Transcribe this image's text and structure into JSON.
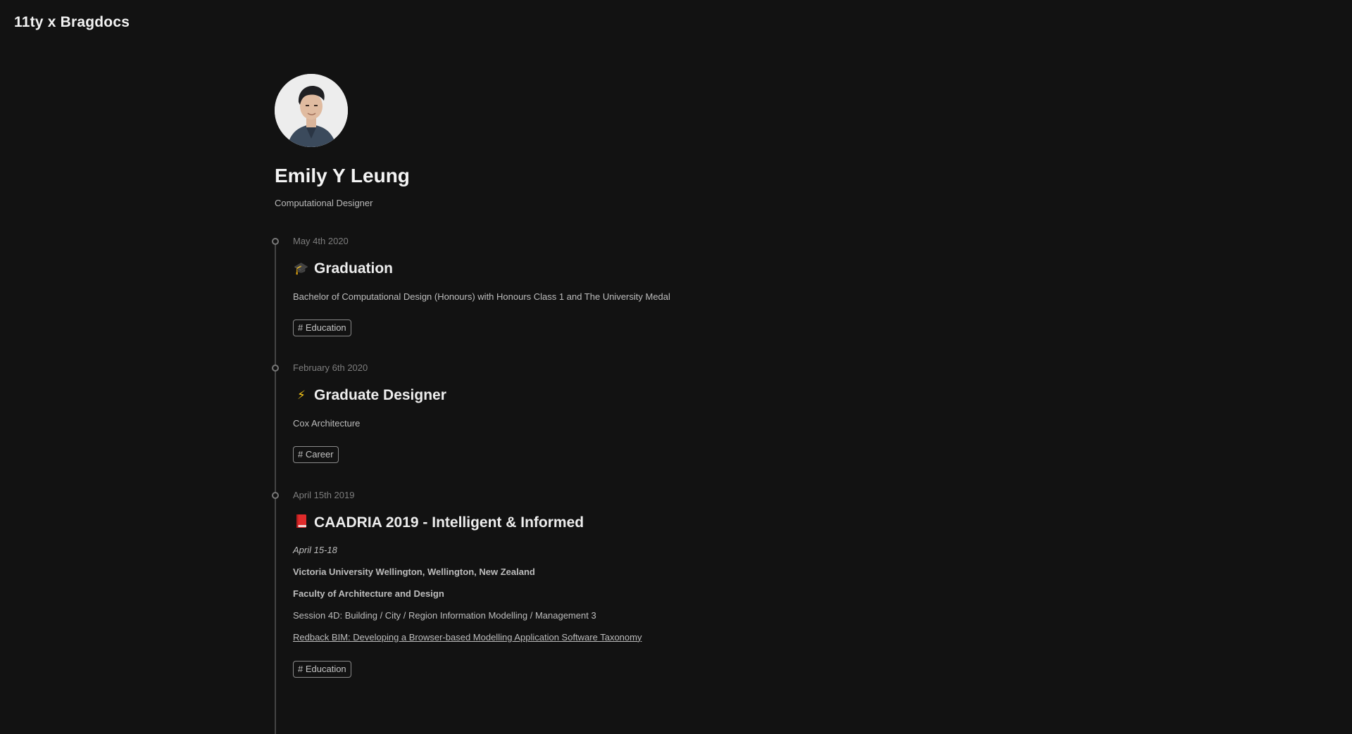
{
  "site": {
    "title": "11ty x Bragdocs"
  },
  "profile": {
    "name": "Emily Y Leung",
    "role": "Computational Designer",
    "avatar_icon": "profile-photo"
  },
  "entries": [
    {
      "date": "May 4th 2020",
      "emoji": "🎓",
      "emoji_icon": "graduation-cap-icon",
      "title": "Graduation",
      "description": "Bachelor of Computational Design (Honours) with Honours Class 1 and The University Medal",
      "tag": "# Education"
    },
    {
      "date": "February 6th 2020",
      "emoji": "⚡",
      "emoji_icon": "lightning-icon",
      "title": "Graduate Designer",
      "description": "Cox Architecture",
      "tag": "# Career"
    },
    {
      "date": "April 15th 2019",
      "emoji": "📕",
      "emoji_icon": "red-book-icon",
      "title": "CAADRIA 2019 - Intelligent & Informed",
      "dates_line": "April 15-18",
      "venue": "Victoria University Wellington, Wellington, New Zealand",
      "faculty": "Faculty of Architecture and Design",
      "session": "Session 4D: Building / City / Region Information Modelling / Management 3",
      "paper_link": "Redback BIM: Developing a Browser-based Modelling Application Software Taxonomy",
      "tag": "# Education"
    }
  ]
}
